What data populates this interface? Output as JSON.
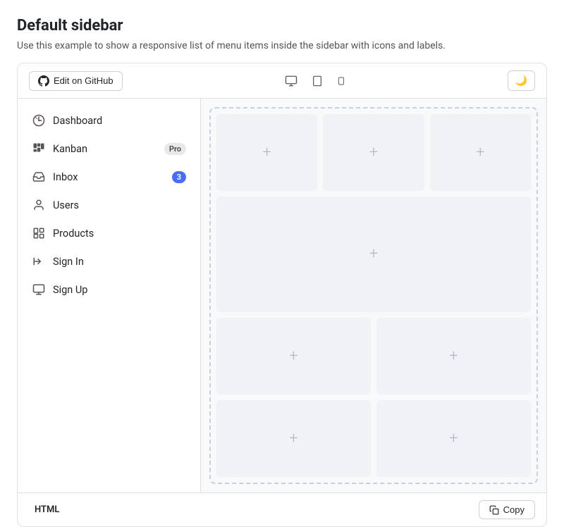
{
  "page": {
    "title": "Default sidebar",
    "description": "Use this example to show a responsive list of menu items inside the sidebar with icons and labels."
  },
  "toolbar": {
    "github_button_label": "Edit on GitHub",
    "dark_mode_icon": "🌙"
  },
  "sidebar": {
    "items": [
      {
        "id": "dashboard",
        "label": "Dashboard",
        "icon": "dashboard",
        "badge": null
      },
      {
        "id": "kanban",
        "label": "Kanban",
        "icon": "kanban",
        "badge": {
          "type": "pro",
          "text": "Pro"
        }
      },
      {
        "id": "inbox",
        "label": "Inbox",
        "icon": "inbox",
        "badge": {
          "type": "count",
          "text": "3"
        }
      },
      {
        "id": "users",
        "label": "Users",
        "icon": "users",
        "badge": null
      },
      {
        "id": "products",
        "label": "Products",
        "icon": "products",
        "badge": null
      },
      {
        "id": "signin",
        "label": "Sign In",
        "icon": "signin",
        "badge": null
      },
      {
        "id": "signup",
        "label": "Sign Up",
        "icon": "signup",
        "badge": null
      }
    ]
  },
  "bottom_bar": {
    "tab_label": "HTML",
    "copy_label": "Copy"
  }
}
